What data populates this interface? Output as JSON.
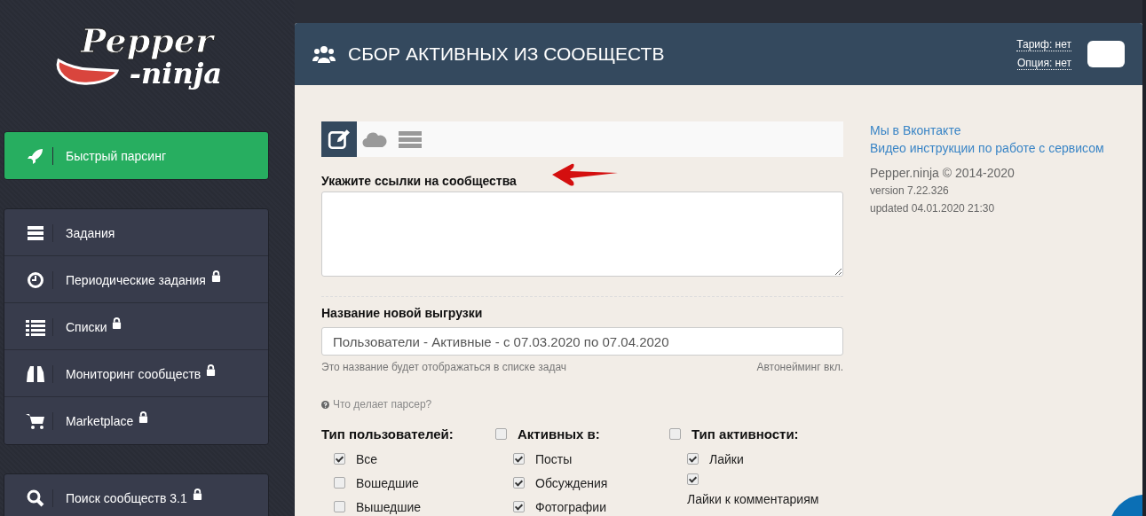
{
  "logo": {
    "line1": "Pepper",
    "line2": "-ninja"
  },
  "sidebar": {
    "groups": [
      {
        "items": [
          {
            "label": "Быстрый парсинг",
            "locked": false,
            "selected": true
          }
        ]
      },
      {
        "items": [
          {
            "label": "Задания",
            "locked": false,
            "selected": false
          },
          {
            "label": "Периодические задания",
            "locked": true,
            "selected": false
          },
          {
            "label": "Списки",
            "locked": true,
            "selected": false
          },
          {
            "label": "Мониторинг сообществ",
            "locked": true,
            "selected": false
          },
          {
            "label": "Marketplace",
            "locked": true,
            "selected": false
          }
        ]
      },
      {
        "items": [
          {
            "label": "Поиск сообществ 3.1",
            "locked": true,
            "selected": false
          }
        ]
      }
    ]
  },
  "header": {
    "title": "СБОР АКТИВНЫХ ИЗ СООБЩЕСТВ",
    "tariff": "Тариф: нет",
    "option": "Опция: нет"
  },
  "source_tabs": [
    {
      "selected": true
    },
    {
      "selected": false
    },
    {
      "selected": false
    }
  ],
  "links_field": {
    "label": "Укажите ссылки на сообщества"
  },
  "name_field": {
    "label": "Название новой выгрузки",
    "value": "Пользователи - Активные - с 07.03.2020 по 07.04.2020",
    "hint": "Это название будет отображаться в списке задач",
    "autonaming": "Автонейминг вкл."
  },
  "help_link": "Что делает парсер?",
  "option_columns": [
    {
      "title": "Тип пользователей:",
      "kind": "plain",
      "items": [
        {
          "label": "Все",
          "checked": true,
          "kind": "inline"
        },
        {
          "label": "Вошедшие",
          "checked": false,
          "kind": "inline"
        },
        {
          "label": "Вышедшие",
          "checked": false,
          "kind": "inline"
        }
      ]
    },
    {
      "title": "Активных в:",
      "kind": "checkbox",
      "checked": false,
      "items": [
        {
          "label": "Посты",
          "checked": true,
          "kind": "inline"
        },
        {
          "label": "Обсуждения",
          "checked": true,
          "kind": "inline"
        },
        {
          "label": "Фотографии",
          "checked": true,
          "kind": "inline"
        }
      ]
    },
    {
      "title": "Тип активности:",
      "kind": "checkbox",
      "checked": false,
      "items": [
        {
          "label": "Лайки",
          "checked": true,
          "kind": "inline"
        },
        {
          "label": "Лайки к комментариям",
          "checked": true,
          "kind": "stacked"
        }
      ]
    }
  ],
  "info": {
    "links": [
      "Мы в Вконтакте",
      "Видео инструкции по работе с сервисом"
    ],
    "copyright": "Pepper.ninja © 2014-2020",
    "version": "version 7.22.326",
    "updated": "updated 04.01.2020 21:30"
  }
}
